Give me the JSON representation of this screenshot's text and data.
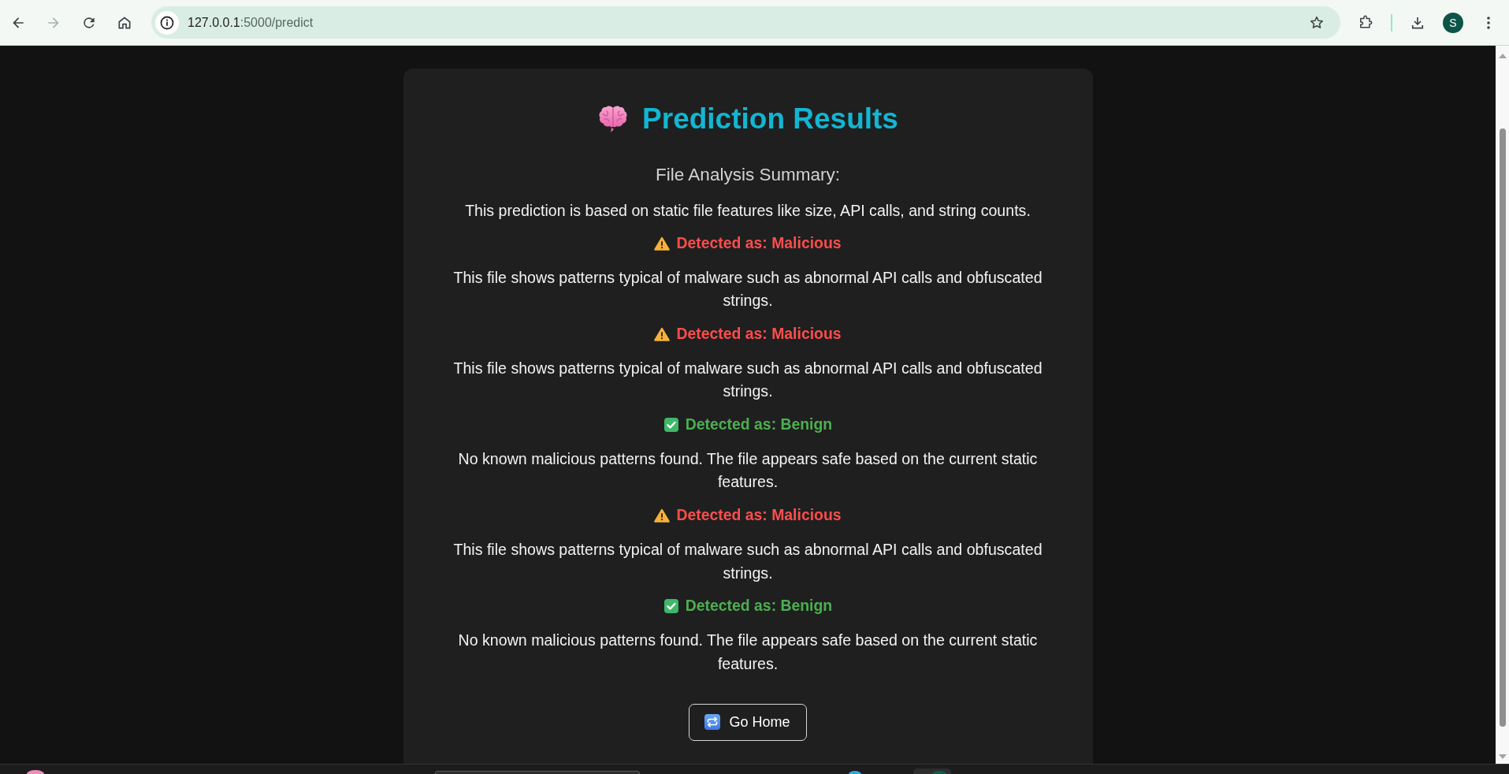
{
  "browser": {
    "address": {
      "host": "127.0.0.1",
      "path": ":5000/predict"
    },
    "forward_disabled": true,
    "profile_initial": "S"
  },
  "page": {
    "title": "Prediction Results",
    "subtitle": "File Analysis Summary:",
    "intro": "This prediction is based on static file features like size, API calls, and string counts.",
    "results": [
      {
        "kind": "malicious",
        "label": "Detected as: Malicious",
        "description": "This file shows patterns typical of malware such as abnormal API calls and obfuscated strings."
      },
      {
        "kind": "malicious",
        "label": "Detected as: Malicious",
        "description": "This file shows patterns typical of malware such as abnormal API calls and obfuscated strings."
      },
      {
        "kind": "benign",
        "label": "Detected as: Benign",
        "description": "No known malicious patterns found. The file appears safe based on the current static features."
      },
      {
        "kind": "malicious",
        "label": "Detected as: Malicious",
        "description": "This file shows patterns typical of malware such as abnormal API calls and obfuscated strings."
      },
      {
        "kind": "benign",
        "label": "Detected as: Benign",
        "description": "No known malicious patterns found. The file appears safe based on the current static features."
      }
    ],
    "home_button": "Go Home"
  }
}
